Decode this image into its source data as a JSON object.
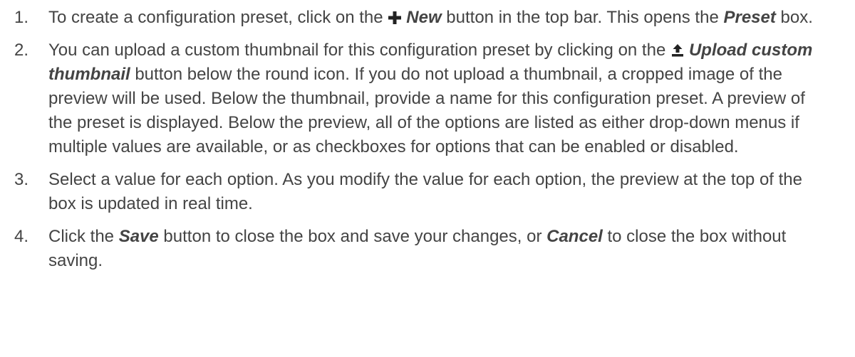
{
  "steps": [
    {
      "number": "1.",
      "text_a": "To create a configuration preset, click on the ",
      "button_new": "New",
      "text_b": " button in the top bar. This opens the ",
      "box_preset": "Preset",
      "text_c": " box.",
      "icon": "plus-icon"
    },
    {
      "number": "2.",
      "text_a": "You can upload a custom thumbnail for this configuration preset by clicking on the ",
      "button_upload": "Upload custom thumbnail",
      "text_b": " button below the round icon. If you do not upload a thumbnail, a cropped image of the preview will be used. Below the thumbnail, provide a name for this configuration preset. A preview of the preset is displayed. Below the preview, all of the options are listed as either drop-down menus if multiple values are available, or as checkboxes for options that can be enabled or disabled.",
      "icon": "upload-icon"
    },
    {
      "number": "3.",
      "text_a": "Select a value for each option. As you modify the value for each option, the preview at the top of the box is updated in real time."
    },
    {
      "number": "4.",
      "text_a": "Click the ",
      "button_save": "Save",
      "text_b": " button to close the box and save your changes, or ",
      "button_cancel": "Cancel",
      "text_c": " to close the box without saving."
    }
  ],
  "colors": {
    "text": "#444444",
    "icon": "#222222"
  }
}
